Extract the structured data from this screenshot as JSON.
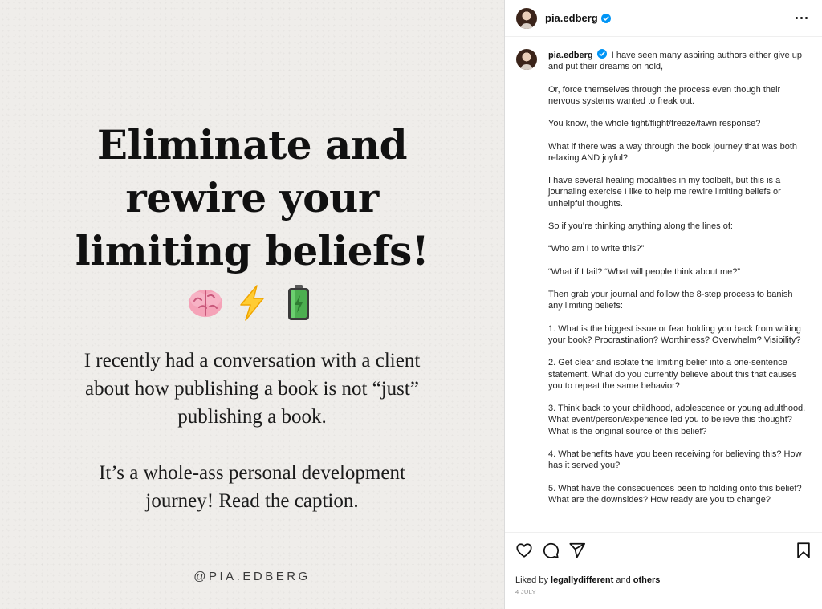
{
  "post_image": {
    "headline_lines": [
      "Eliminate and",
      "rewire your",
      "limiting beliefs!"
    ],
    "emojis": [
      "brain-icon",
      "lightning-icon",
      "battery-icon"
    ],
    "paragraph1_lines": [
      "I recently had a conversation with a client",
      "about how publishing a book is not “just”",
      "publishing a book."
    ],
    "paragraph2_lines": [
      "It’s a whole-ass personal development",
      "journey! Read the caption."
    ],
    "handle": "@PIA.EDBERG"
  },
  "header": {
    "username": "pia.edberg"
  },
  "caption": {
    "username": "pia.edberg",
    "first_text": "I have seen many aspiring authors either give up and put their dreams on hold,",
    "paragraphs": [
      "Or, force themselves through the process even though their nervous systems wanted to freak out.",
      "You know, the whole fight/flight/freeze/fawn response?",
      "What if there was a way through the book journey that was both relaxing AND joyful?",
      "I have several healing modalities in my toolbelt, but this is a journaling exercise I like to help me rewire limiting beliefs or unhelpful thoughts.",
      "So if you’re thinking anything along the lines of:",
      "“Who am I to write this?”",
      "“What if I fail?  “What will people think about me?”",
      "Then grab your journal and follow the 8-step process to banish any limiting beliefs:",
      "1. What is the biggest issue or fear holding you back from writing your book? Procrastination? Worthiness? Overwhelm? Visibility?",
      "2. Get clear and isolate the limiting belief into a one-sentence statement. What do you currently believe about this that causes you to repeat the same behavior?",
      "3. Think back to your childhood, adolescence or young adulthood. What event/person/experience led you to believe this thought? What is the original source of this belief?",
      "4. What benefits have you been receiving for believing this? How has it served you?",
      "5. What have the consequences been to holding onto this belief? What are the downsides? How ready are you to change?"
    ]
  },
  "actions": {
    "icons": [
      "heart-icon",
      "comment-icon",
      "share-icon",
      "bookmark-icon"
    ],
    "liked_by_prefix": "Liked by ",
    "liked_by_user": "legallydifferent",
    "liked_by_and": " and ",
    "liked_by_others": "others",
    "date": "4 JULY"
  },
  "colors": {
    "verified": "#0095f6",
    "image_bg": "#efedea"
  }
}
